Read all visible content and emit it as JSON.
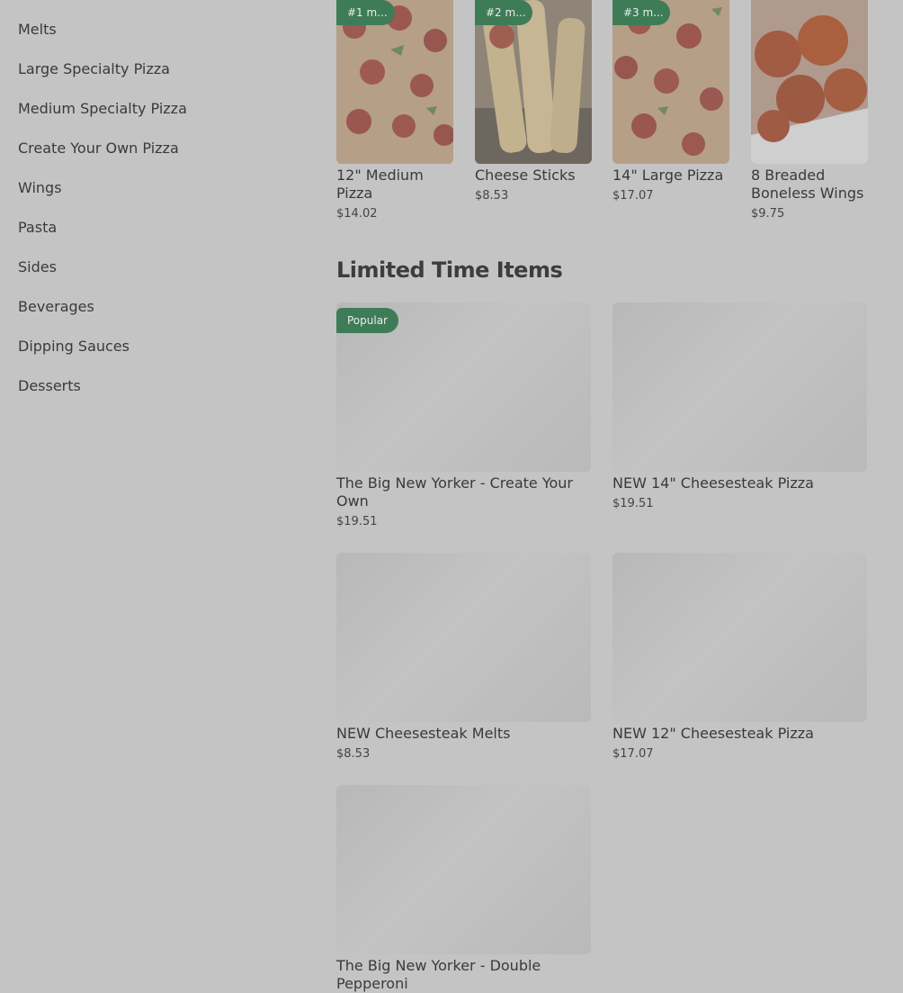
{
  "sidebar": {
    "items": [
      {
        "label": "Melts"
      },
      {
        "label": "Large Specialty Pizza"
      },
      {
        "label": "Medium Specialty Pizza"
      },
      {
        "label": "Create Your Own Pizza"
      },
      {
        "label": "Wings"
      },
      {
        "label": "Pasta"
      },
      {
        "label": "Sides"
      },
      {
        "label": "Beverages"
      },
      {
        "label": "Dipping Sauces"
      },
      {
        "label": "Desserts"
      }
    ]
  },
  "most_ordered": {
    "items": [
      {
        "badge": "#1 m...",
        "name": "12\" Medium Pizza",
        "price": "$14.02"
      },
      {
        "badge": "#2 m...",
        "name": "Cheese Sticks",
        "price": "$8.53"
      },
      {
        "badge": "#3 m...",
        "name": "14\" Large Pizza",
        "price": "$17.07"
      },
      {
        "badge": "",
        "name": "8 Breaded Boneless Wings",
        "price": "$9.75"
      }
    ]
  },
  "limited_time": {
    "title": "Limited Time Items",
    "items": [
      {
        "badge": "Popular",
        "name": "The Big New Yorker - Create Your Own",
        "price": "$19.51"
      },
      {
        "badge": "",
        "name": "NEW 14\" Cheesesteak Pizza",
        "price": "$19.51"
      },
      {
        "badge": "",
        "name": "NEW Cheesesteak Melts",
        "price": "$8.53"
      },
      {
        "badge": "",
        "name": "NEW 12\" Cheesesteak Pizza",
        "price": "$17.07"
      },
      {
        "badge": "",
        "name": "The Big New Yorker - Double Pepperoni",
        "price": ""
      }
    ]
  }
}
